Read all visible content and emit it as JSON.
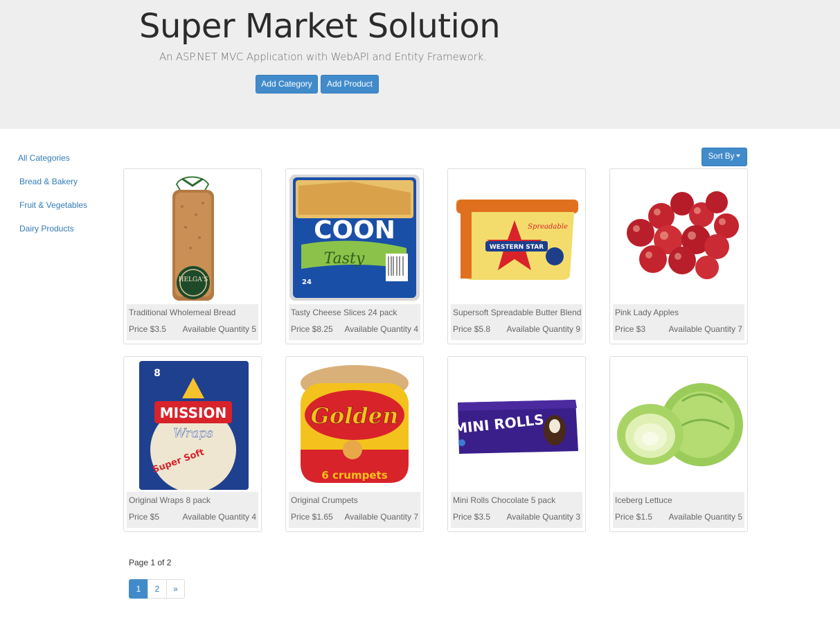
{
  "header": {
    "title": "Super Market Solution",
    "subtitle": "An ASP.NET MVC Application with WebAPI and Entity Framework.",
    "add_category_label": "Add Category",
    "add_product_label": "Add Product"
  },
  "sidebar": {
    "items": [
      {
        "label": "All Categories"
      },
      {
        "label": "Bread & Bakery"
      },
      {
        "label": "Fruit & Vegetables"
      },
      {
        "label": "Dairy Products"
      }
    ]
  },
  "toolbar": {
    "sort_label": "Sort By"
  },
  "products": [
    {
      "name": "Traditional Wholemeal Bread",
      "price": "Price $3.5",
      "quantity": "Available Quantity 5",
      "image_icon": "bread-loaf-image"
    },
    {
      "name": "Tasty Cheese Slices 24 pack",
      "price": "Price $8.25",
      "quantity": "Available Quantity 4",
      "image_icon": "cheese-slices-image"
    },
    {
      "name": "Supersoft Spreadable Butter Blend",
      "price": "Price $5.8",
      "quantity": "Available Quantity 9",
      "image_icon": "butter-tub-image"
    },
    {
      "name": "Pink Lady Apples",
      "price": "Price $3",
      "quantity": "Available Quantity 7",
      "image_icon": "apples-image"
    },
    {
      "name": "Original Wraps 8 pack",
      "price": "Price $5",
      "quantity": "Available Quantity 4",
      "image_icon": "wraps-pack-image"
    },
    {
      "name": "Original Crumpets",
      "price": "Price $1.65",
      "quantity": "Available Quantity 7",
      "image_icon": "crumpets-pack-image"
    },
    {
      "name": "Mini Rolls Chocolate 5 pack",
      "price": "Price $3.5",
      "quantity": "Available Quantity 3",
      "image_icon": "mini-rolls-pack-image"
    },
    {
      "name": "Iceberg Lettuce",
      "price": "Price $1.5",
      "quantity": "Available Quantity 5",
      "image_icon": "lettuce-image"
    }
  ],
  "image_text": {
    "bread_brand": "HELGA'S",
    "cheese_brand": "COON",
    "cheese_variant": "Tasty",
    "cheese_count": "24",
    "butter_brand": "WESTERN STAR",
    "butter_tag": "Spreadable",
    "wraps_brand": "MISSION",
    "wraps_variant": "Wraps",
    "wraps_tag": "Super Soft",
    "crumpets_brand": "Golden",
    "crumpets_count": "6 crumpets",
    "rolls_brand": "MINI ROLLS"
  },
  "pagination": {
    "info": "Page 1 of 2",
    "pages": [
      "1",
      "2"
    ],
    "next": "»",
    "current": 1
  },
  "colors": {
    "primary": "#428bca",
    "link": "#337ab7",
    "header_bg": "#eeeeee",
    "card_info_bg": "#eeeeee"
  }
}
